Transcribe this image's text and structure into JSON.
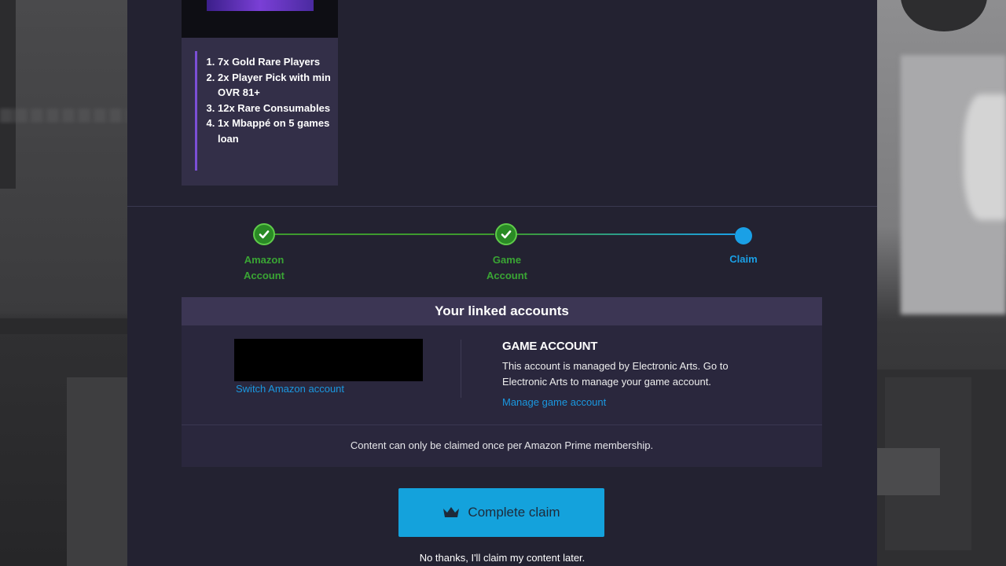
{
  "rewards": [
    "7x Gold Rare Players",
    "2x Player Pick with min OVR 81+",
    "12x Rare Consumables",
    "1x Mbappé on 5 games loan"
  ],
  "stepper": {
    "steps": [
      {
        "label_line1": "Amazon",
        "label_line2": "Account",
        "status": "complete"
      },
      {
        "label_line1": "Game",
        "label_line2": "Account",
        "status": "complete"
      },
      {
        "label_line1": "Claim",
        "label_line2": "",
        "status": "current"
      }
    ]
  },
  "linked_accounts": {
    "title": "Your linked accounts",
    "switch_amazon_link": "Switch Amazon account",
    "game_account": {
      "heading": "GAME ACCOUNT",
      "description": "This account is managed by Electronic Arts. Go to Electronic Arts to manage your game account.",
      "manage_link": "Manage game account"
    },
    "notice": "Content can only be claimed once per Amazon Prime membership."
  },
  "actions": {
    "complete_claim": "Complete claim",
    "decline": "No thanks, I'll claim my content later."
  },
  "colors": {
    "modal_bg": "#232231",
    "accent_blue": "#14a2dc",
    "success_green": "#3aa534",
    "link_blue": "#1a98e0"
  }
}
